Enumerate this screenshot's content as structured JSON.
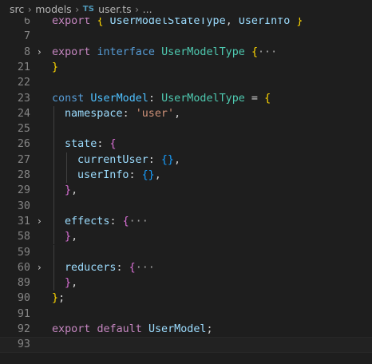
{
  "breadcrumb": {
    "items": [
      "src",
      "models",
      "user.ts",
      "..."
    ],
    "file_icon": "TS"
  },
  "editor": {
    "lines": [
      {
        "num": "6",
        "fold": "",
        "indent": 0,
        "tokens": [
          {
            "t": "export",
            "c": "kw-c"
          },
          {
            "t": " ",
            "c": "p"
          },
          {
            "t": "{",
            "c": "b1"
          },
          {
            "t": " UserModelStateType",
            "c": "vr"
          },
          {
            "t": ", ",
            "c": "p"
          },
          {
            "t": "UserInfo",
            "c": "vr"
          },
          {
            "t": " ",
            "c": "p"
          },
          {
            "t": "}",
            "c": "b1"
          }
        ]
      },
      {
        "num": "7",
        "fold": "",
        "indent": 0,
        "tokens": []
      },
      {
        "num": "8",
        "fold": "›",
        "indent": 0,
        "tokens": [
          {
            "t": "export",
            "c": "kw-c"
          },
          {
            "t": " ",
            "c": "p"
          },
          {
            "t": "interface",
            "c": "kw-b"
          },
          {
            "t": " ",
            "c": "p"
          },
          {
            "t": "UserModelType",
            "c": "ty"
          },
          {
            "t": " ",
            "c": "p"
          },
          {
            "t": "{",
            "c": "b1"
          },
          {
            "t": "···",
            "c": "ell"
          }
        ]
      },
      {
        "num": "21",
        "fold": "",
        "indent": 0,
        "tokens": [
          {
            "t": "}",
            "c": "b1"
          }
        ]
      },
      {
        "num": "22",
        "fold": "",
        "indent": 0,
        "tokens": []
      },
      {
        "num": "23",
        "fold": "",
        "indent": 0,
        "tokens": [
          {
            "t": "const",
            "c": "kw-b"
          },
          {
            "t": " ",
            "c": "p"
          },
          {
            "t": "UserModel",
            "c": "cn"
          },
          {
            "t": ": ",
            "c": "p"
          },
          {
            "t": "UserModelType",
            "c": "ty"
          },
          {
            "t": " = ",
            "c": "p"
          },
          {
            "t": "{",
            "c": "b1"
          }
        ]
      },
      {
        "num": "24",
        "fold": "",
        "indent": 1,
        "tokens": [
          {
            "t": "namespace",
            "c": "vr"
          },
          {
            "t": ": ",
            "c": "p"
          },
          {
            "t": "'user'",
            "c": "str"
          },
          {
            "t": ",",
            "c": "p"
          }
        ]
      },
      {
        "num": "25",
        "fold": "",
        "indent": 1,
        "tokens": []
      },
      {
        "num": "26",
        "fold": "",
        "indent": 1,
        "tokens": [
          {
            "t": "state",
            "c": "vr"
          },
          {
            "t": ": ",
            "c": "p"
          },
          {
            "t": "{",
            "c": "b2"
          }
        ]
      },
      {
        "num": "27",
        "fold": "",
        "indent": 2,
        "tokens": [
          {
            "t": "currentUser",
            "c": "vr"
          },
          {
            "t": ": ",
            "c": "p"
          },
          {
            "t": "{}",
            "c": "b3"
          },
          {
            "t": ",",
            "c": "p"
          }
        ]
      },
      {
        "num": "28",
        "fold": "",
        "indent": 2,
        "tokens": [
          {
            "t": "userInfo",
            "c": "vr"
          },
          {
            "t": ": ",
            "c": "p"
          },
          {
            "t": "{}",
            "c": "b3"
          },
          {
            "t": ",",
            "c": "p"
          }
        ]
      },
      {
        "num": "29",
        "fold": "",
        "indent": 1,
        "tokens": [
          {
            "t": "}",
            "c": "b2"
          },
          {
            "t": ",",
            "c": "p"
          }
        ]
      },
      {
        "num": "30",
        "fold": "",
        "indent": 1,
        "tokens": []
      },
      {
        "num": "31",
        "fold": "›",
        "indent": 1,
        "tokens": [
          {
            "t": "effects",
            "c": "vr"
          },
          {
            "t": ": ",
            "c": "p"
          },
          {
            "t": "{",
            "c": "b2"
          },
          {
            "t": "···",
            "c": "ell"
          }
        ]
      },
      {
        "num": "58",
        "fold": "",
        "indent": 1,
        "tokens": [
          {
            "t": "}",
            "c": "b2"
          },
          {
            "t": ",",
            "c": "p"
          }
        ]
      },
      {
        "num": "59",
        "fold": "",
        "indent": 1,
        "tokens": []
      },
      {
        "num": "60",
        "fold": "›",
        "indent": 1,
        "tokens": [
          {
            "t": "reducers",
            "c": "vr"
          },
          {
            "t": ": ",
            "c": "p"
          },
          {
            "t": "{",
            "c": "b2"
          },
          {
            "t": "···",
            "c": "ell"
          }
        ]
      },
      {
        "num": "89",
        "fold": "",
        "indent": 1,
        "tokens": [
          {
            "t": "}",
            "c": "b2"
          },
          {
            "t": ",",
            "c": "p"
          }
        ]
      },
      {
        "num": "90",
        "fold": "",
        "indent": 0,
        "tokens": [
          {
            "t": "}",
            "c": "b1"
          },
          {
            "t": ";",
            "c": "p"
          }
        ]
      },
      {
        "num": "91",
        "fold": "",
        "indent": 0,
        "tokens": []
      },
      {
        "num": "92",
        "fold": "",
        "indent": 0,
        "tokens": [
          {
            "t": "export",
            "c": "kw-c"
          },
          {
            "t": " ",
            "c": "p"
          },
          {
            "t": "default",
            "c": "kw-c"
          },
          {
            "t": " ",
            "c": "p"
          },
          {
            "t": "UserModel",
            "c": "vr"
          },
          {
            "t": ";",
            "c": "p"
          }
        ]
      },
      {
        "num": "93",
        "fold": "",
        "indent": 0,
        "current": true,
        "tokens": []
      }
    ]
  },
  "colors": {
    "background": "#1e1e1e",
    "line_number": "#858585",
    "keyword_control": "#c586c0",
    "keyword_storage": "#569cd6",
    "type": "#4ec9b0",
    "variable": "#9cdcfe",
    "constant": "#4fc1ff",
    "string": "#ce9178",
    "bracket_level1": "#ffd700",
    "bracket_level2": "#da70d6",
    "bracket_level3": "#179fff"
  }
}
